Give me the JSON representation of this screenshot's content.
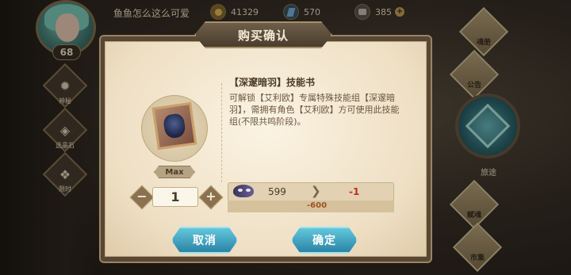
{
  "player": {
    "name": "鱼鱼怎么这么可爱",
    "level": "68"
  },
  "resources": {
    "gold": "41329",
    "crystal": "570",
    "ore": "385"
  },
  "left_menu": [
    {
      "label": "神秘",
      "icon": "mystery-icon"
    },
    {
      "label": "选晶石",
      "icon": "crystal-dice-icon"
    },
    {
      "label": "限时",
      "icon": "limited-time-icon"
    }
  ],
  "right_menu": [
    {
      "label": "魂册",
      "icon": "soul-book-icon"
    },
    {
      "label": "公告",
      "icon": "announcement-icon"
    },
    {
      "label": "旅途",
      "icon": "journey-icon"
    },
    {
      "label": "赋魂",
      "icon": "soul-infuse-icon"
    },
    {
      "label": "市集",
      "icon": "market-icon"
    }
  ],
  "dialog": {
    "title": "购买确认",
    "item": {
      "name": "【深邃暗羽】技能书",
      "description": "可解锁【艾利欧】专属特殊技能组【深邃暗羽】，需拥有角色【艾利欧】方可使用此技能组(不限共鸣阶段)。",
      "max_label": "Max",
      "icon": "skill-book-icon"
    },
    "quantity": "1",
    "cost": {
      "currency_icon": "mask-currency-icon",
      "have": "599",
      "after": "-1",
      "delta": "-600"
    },
    "buttons": {
      "cancel": "取消",
      "confirm": "确定"
    }
  },
  "colors": {
    "button_accent": "#2a84a6",
    "negative": "#c52a20",
    "panel": "#eedfc4"
  }
}
